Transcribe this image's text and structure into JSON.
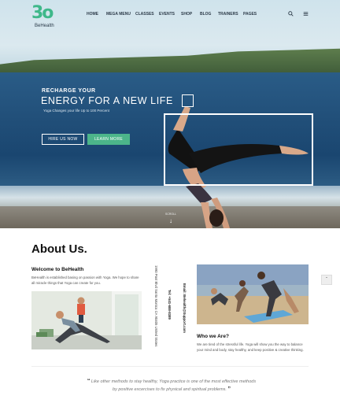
{
  "brand": {
    "logo_text": "3o",
    "name": "BeHealth"
  },
  "nav": {
    "items": [
      "HOME",
      "MEGA MENU",
      "CLASSES",
      "EVENTS",
      "SHOP",
      "BLOG",
      "TRAINERS",
      "PAGES"
    ],
    "search_icon": "search-icon",
    "menu_icon": "hamburger-icon"
  },
  "hero": {
    "kicker": "RECHARGE YOUR",
    "headline": "ENERGY FOR A NEW LIFE",
    "subtitle": "Yoga Changes your life Up to 100 Percent",
    "hire_label": "HIRE US NOW",
    "learn_label": "LEARN MORE",
    "scroll_label": "SCROLL",
    "accent_color": "#4cb58a"
  },
  "about": {
    "title": "About Us.",
    "welcome_title": "Welcome to BeHealth",
    "welcome_body": "BeHealth is established basing on passion with Yoga. We hope to share all miracle things that Yoga can create for you.",
    "address": "1990 Post Blvd Santa Monica CA 90405 United States",
    "phone": "Tel: +541-688-8389",
    "email": "Email: Behealth@Support.com",
    "who_title": "Who we Are?",
    "who_body": "We are tired of the stressful life. Yoga will show you the way to balance your mind and body, stay healthy, and keep positive & creative thinking.",
    "up_icon": "chevron-up-icon"
  },
  "quote": {
    "open": "“",
    "text": "Like other methods to stay healthy, Yoga practice is one of the most effective methods by positive excercises to fix physical and spiritual problems.",
    "close": "”"
  }
}
